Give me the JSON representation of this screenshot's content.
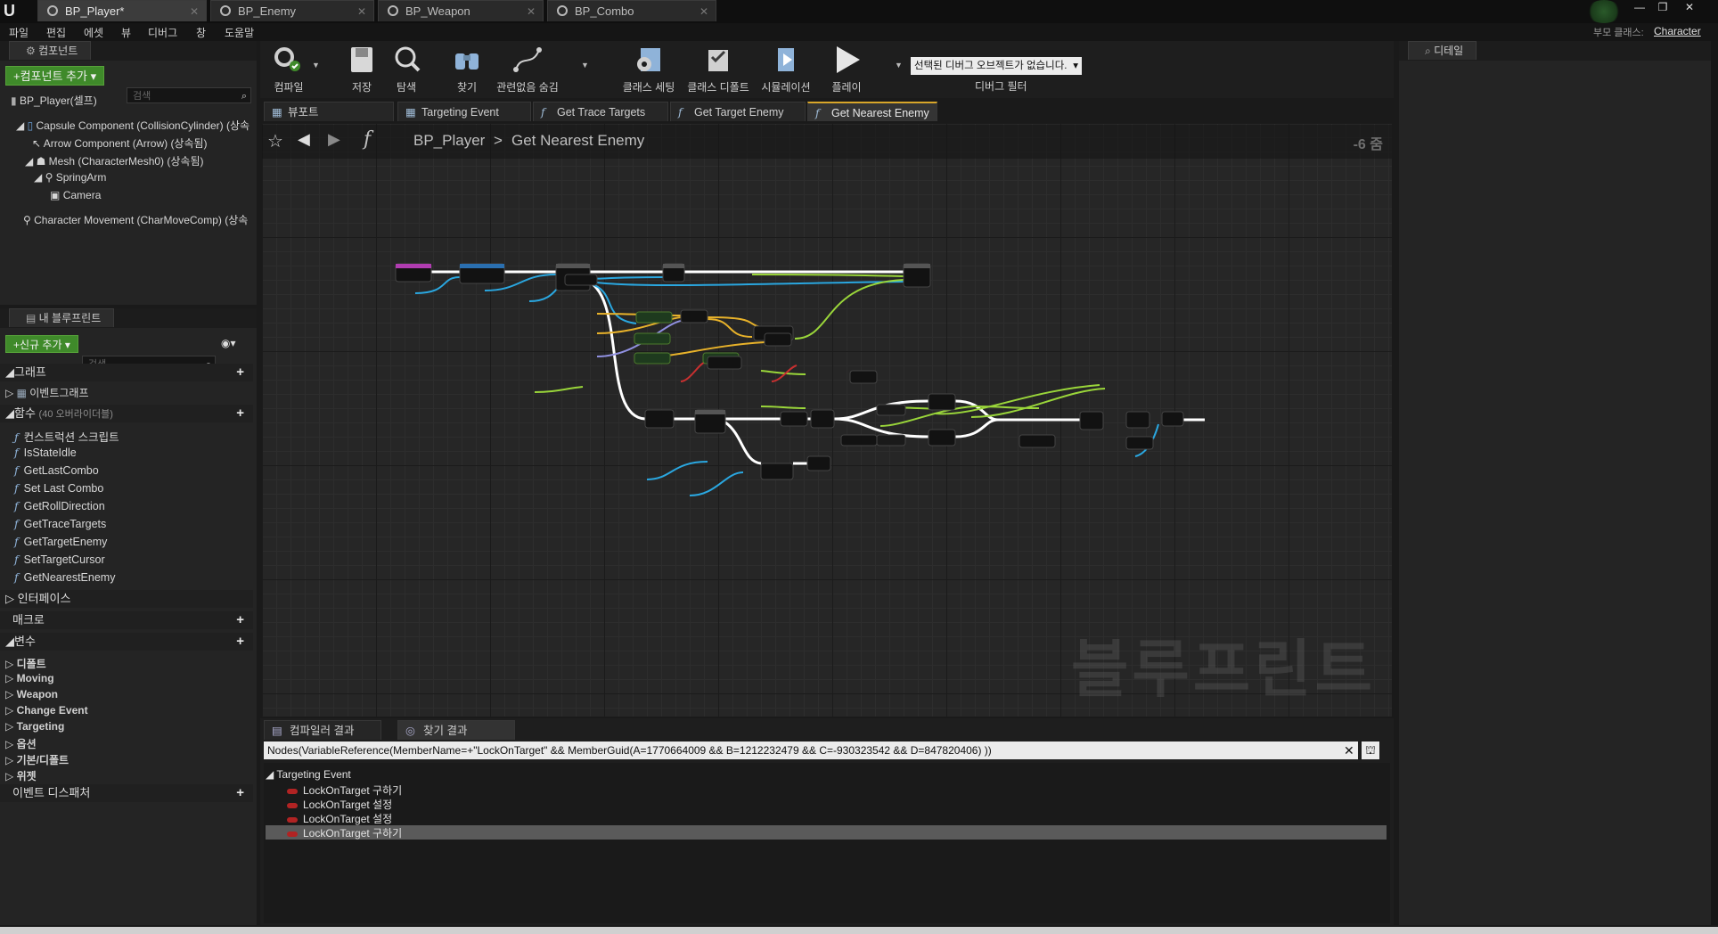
{
  "doc_tabs": [
    {
      "label": "BP_Player*",
      "active": true
    },
    {
      "label": "BP_Enemy",
      "active": false
    },
    {
      "label": "BP_Weapon",
      "active": false
    },
    {
      "label": "BP_Combo",
      "active": false
    }
  ],
  "menu": [
    "파일",
    "편집",
    "에셋",
    "뷰",
    "디버그",
    "창",
    "도움말"
  ],
  "parent_class": {
    "label": "부모 클래스:",
    "value": "Character"
  },
  "components": {
    "title": "컴포넌트",
    "add_button": "+컴포넌트 추가 ▾",
    "search_placeholder": "검색",
    "self_label": "BP_Player(셀프)",
    "tree": [
      "Capsule Component (CollisionCylinder) (상속",
      "Arrow Component (Arrow) (상속됨)",
      "Mesh (CharacterMesh0) (상속됨)",
      "SpringArm",
      "Camera",
      "Character Movement (CharMoveComp) (상속"
    ]
  },
  "my_blueprint": {
    "title": "내 블루프린트",
    "add_button": "+신규 추가 ▾",
    "search_placeholder": "검색",
    "graph_section": "그래프",
    "event_graph": "이벤트그래프",
    "functions_section": "함수",
    "functions_overridable": "(40 오버라이더블)",
    "functions": [
      "컨스트럭션 스크립트",
      "IsStateIdle",
      "GetLastCombo",
      "Set Last Combo",
      "GetRollDirection",
      "GetTraceTargets",
      "GetTargetEnemy",
      "SetTargetCursor",
      "GetNearestEnemy"
    ],
    "interfaces": "인터페이스",
    "macros": "매크로",
    "variables": "변수",
    "categories": [
      "디폴트",
      "Moving",
      "Weapon",
      "Change Event",
      "Targeting",
      "옵션",
      "기본/디폴트",
      "위젯"
    ],
    "dispatchers": "이벤트 디스패처"
  },
  "toolbar": {
    "buttons": [
      "컴파일",
      "저장",
      "탐색",
      "찾기",
      "관련없음 숨김",
      "클래스 세팅",
      "클래스 디폴트",
      "시뮬레이션",
      "플레이"
    ],
    "debug_select": "선택된 디버그 오브젝트가 없습니다.",
    "debug_filter": "디버그 필터"
  },
  "graph_tabs": [
    {
      "label": "뷰포트",
      "icon": "grid-icon"
    },
    {
      "label": "Targeting Event",
      "icon": "grid-icon"
    },
    {
      "label": "Get Trace Targets",
      "icon": "function-icon"
    },
    {
      "label": "Get Target Enemy",
      "icon": "function-icon"
    },
    {
      "label": "Get Nearest Enemy",
      "icon": "function-icon",
      "active": true
    }
  ],
  "breadcrumb": {
    "root": "BP_Player",
    "sep": ">",
    "current": "Get Nearest Enemy",
    "zoom": "-6 줌"
  },
  "watermark": "블루프린트",
  "results": {
    "tabs": [
      "컴파일러 결과",
      "찾기 결과"
    ],
    "query": "Nodes(VariableReference(MemberName=+\"LockOnTarget\" && MemberGuid(A=1770664009 && B=1212232479 && C=-930323542 && D=847820406) ))",
    "group": "Targeting Event",
    "rows": [
      "LockOnTarget 구하기",
      "LockOnTarget 설정",
      "LockOnTarget 설정",
      "LockOnTarget 구하기"
    ]
  },
  "details": {
    "title": "디테일"
  },
  "colors": {
    "accent_green": "#3f8a2a",
    "exec_wire": "#ffffff",
    "object_wire": "#2aa7e0",
    "vector_wire": "#e8b22a",
    "float_wire": "#9ad63a"
  }
}
